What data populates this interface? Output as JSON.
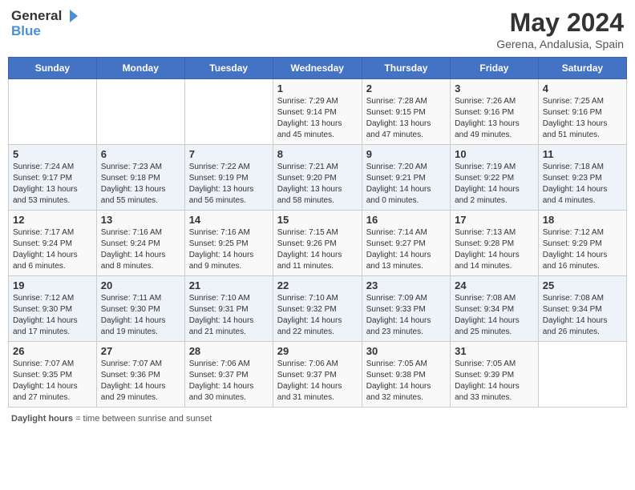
{
  "header": {
    "logo_general": "General",
    "logo_blue": "Blue",
    "month_year": "May 2024",
    "location": "Gerena, Andalusia, Spain"
  },
  "footer": {
    "label": "Daylight hours"
  },
  "weekdays": [
    "Sunday",
    "Monday",
    "Tuesday",
    "Wednesday",
    "Thursday",
    "Friday",
    "Saturday"
  ],
  "weeks": [
    [
      {
        "day": "",
        "info": ""
      },
      {
        "day": "",
        "info": ""
      },
      {
        "day": "",
        "info": ""
      },
      {
        "day": "1",
        "info": "Sunrise: 7:29 AM\nSunset: 9:14 PM\nDaylight: 13 hours\nand 45 minutes."
      },
      {
        "day": "2",
        "info": "Sunrise: 7:28 AM\nSunset: 9:15 PM\nDaylight: 13 hours\nand 47 minutes."
      },
      {
        "day": "3",
        "info": "Sunrise: 7:26 AM\nSunset: 9:16 PM\nDaylight: 13 hours\nand 49 minutes."
      },
      {
        "day": "4",
        "info": "Sunrise: 7:25 AM\nSunset: 9:16 PM\nDaylight: 13 hours\nand 51 minutes."
      }
    ],
    [
      {
        "day": "5",
        "info": "Sunrise: 7:24 AM\nSunset: 9:17 PM\nDaylight: 13 hours\nand 53 minutes."
      },
      {
        "day": "6",
        "info": "Sunrise: 7:23 AM\nSunset: 9:18 PM\nDaylight: 13 hours\nand 55 minutes."
      },
      {
        "day": "7",
        "info": "Sunrise: 7:22 AM\nSunset: 9:19 PM\nDaylight: 13 hours\nand 56 minutes."
      },
      {
        "day": "8",
        "info": "Sunrise: 7:21 AM\nSunset: 9:20 PM\nDaylight: 13 hours\nand 58 minutes."
      },
      {
        "day": "9",
        "info": "Sunrise: 7:20 AM\nSunset: 9:21 PM\nDaylight: 14 hours\nand 0 minutes."
      },
      {
        "day": "10",
        "info": "Sunrise: 7:19 AM\nSunset: 9:22 PM\nDaylight: 14 hours\nand 2 minutes."
      },
      {
        "day": "11",
        "info": "Sunrise: 7:18 AM\nSunset: 9:23 PM\nDaylight: 14 hours\nand 4 minutes."
      }
    ],
    [
      {
        "day": "12",
        "info": "Sunrise: 7:17 AM\nSunset: 9:24 PM\nDaylight: 14 hours\nand 6 minutes."
      },
      {
        "day": "13",
        "info": "Sunrise: 7:16 AM\nSunset: 9:24 PM\nDaylight: 14 hours\nand 8 minutes."
      },
      {
        "day": "14",
        "info": "Sunrise: 7:16 AM\nSunset: 9:25 PM\nDaylight: 14 hours\nand 9 minutes."
      },
      {
        "day": "15",
        "info": "Sunrise: 7:15 AM\nSunset: 9:26 PM\nDaylight: 14 hours\nand 11 minutes."
      },
      {
        "day": "16",
        "info": "Sunrise: 7:14 AM\nSunset: 9:27 PM\nDaylight: 14 hours\nand 13 minutes."
      },
      {
        "day": "17",
        "info": "Sunrise: 7:13 AM\nSunset: 9:28 PM\nDaylight: 14 hours\nand 14 minutes."
      },
      {
        "day": "18",
        "info": "Sunrise: 7:12 AM\nSunset: 9:29 PM\nDaylight: 14 hours\nand 16 minutes."
      }
    ],
    [
      {
        "day": "19",
        "info": "Sunrise: 7:12 AM\nSunset: 9:30 PM\nDaylight: 14 hours\nand 17 minutes."
      },
      {
        "day": "20",
        "info": "Sunrise: 7:11 AM\nSunset: 9:30 PM\nDaylight: 14 hours\nand 19 minutes."
      },
      {
        "day": "21",
        "info": "Sunrise: 7:10 AM\nSunset: 9:31 PM\nDaylight: 14 hours\nand 21 minutes."
      },
      {
        "day": "22",
        "info": "Sunrise: 7:10 AM\nSunset: 9:32 PM\nDaylight: 14 hours\nand 22 minutes."
      },
      {
        "day": "23",
        "info": "Sunrise: 7:09 AM\nSunset: 9:33 PM\nDaylight: 14 hours\nand 23 minutes."
      },
      {
        "day": "24",
        "info": "Sunrise: 7:08 AM\nSunset: 9:34 PM\nDaylight: 14 hours\nand 25 minutes."
      },
      {
        "day": "25",
        "info": "Sunrise: 7:08 AM\nSunset: 9:34 PM\nDaylight: 14 hours\nand 26 minutes."
      }
    ],
    [
      {
        "day": "26",
        "info": "Sunrise: 7:07 AM\nSunset: 9:35 PM\nDaylight: 14 hours\nand 27 minutes."
      },
      {
        "day": "27",
        "info": "Sunrise: 7:07 AM\nSunset: 9:36 PM\nDaylight: 14 hours\nand 29 minutes."
      },
      {
        "day": "28",
        "info": "Sunrise: 7:06 AM\nSunset: 9:37 PM\nDaylight: 14 hours\nand 30 minutes."
      },
      {
        "day": "29",
        "info": "Sunrise: 7:06 AM\nSunset: 9:37 PM\nDaylight: 14 hours\nand 31 minutes."
      },
      {
        "day": "30",
        "info": "Sunrise: 7:05 AM\nSunset: 9:38 PM\nDaylight: 14 hours\nand 32 minutes."
      },
      {
        "day": "31",
        "info": "Sunrise: 7:05 AM\nSunset: 9:39 PM\nDaylight: 14 hours\nand 33 minutes."
      },
      {
        "day": "",
        "info": ""
      }
    ]
  ]
}
